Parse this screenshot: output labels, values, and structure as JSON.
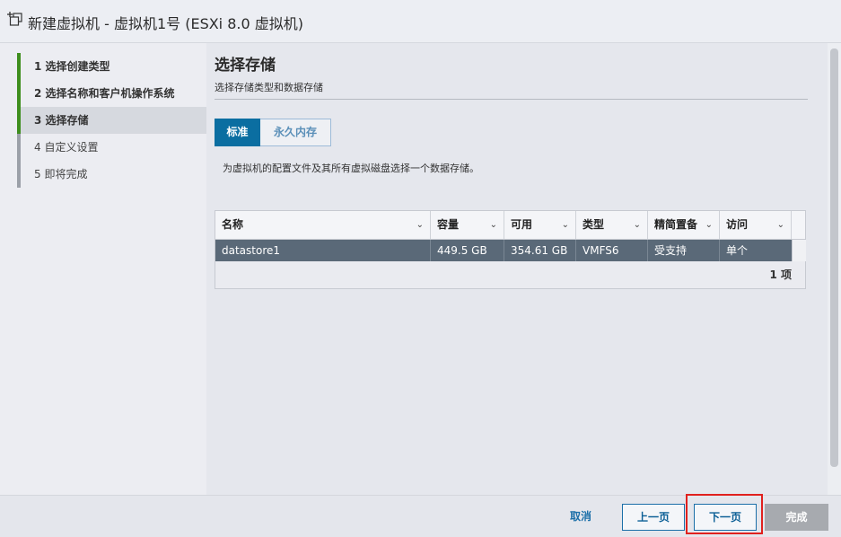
{
  "window": {
    "title": "新建虚拟机 - 虚拟机1号 (ESXi 8.0 虚拟机)",
    "icon": "new-vm-icon"
  },
  "steps": [
    {
      "label": "1  选择创建类型",
      "state": "done"
    },
    {
      "label": "2  选择名称和客户机操作系统",
      "state": "done"
    },
    {
      "label": "3  选择存储",
      "state": "active"
    },
    {
      "label": "4  自定义设置",
      "state": "todo"
    },
    {
      "label": "5  即将完成",
      "state": "todo"
    }
  ],
  "page": {
    "heading": "选择存储",
    "subheading": "选择存储类型和数据存储",
    "tabs": [
      {
        "label": "标准",
        "selected": true
      },
      {
        "label": "永久内存",
        "selected": false
      }
    ],
    "description": "为虚拟机的配置文件及其所有虚拟磁盘选择一个数据存储。"
  },
  "table": {
    "columns": [
      "名称",
      "容量",
      "可用",
      "类型",
      "精简置备",
      "访问"
    ],
    "rows": [
      [
        "datastore1",
        "449.5 GB",
        "354.61 GB",
        "VMFS6",
        "受支持",
        "单个"
      ]
    ],
    "footer": "1 项"
  },
  "footer": {
    "cancel": "取消",
    "back": "上一页",
    "next": "下一页",
    "finish": "完成"
  },
  "colors": {
    "accent": "#0b6ea1",
    "done_step": "#3e8e1e",
    "highlight": "#e0211e",
    "selected_row": "#5a6978"
  }
}
